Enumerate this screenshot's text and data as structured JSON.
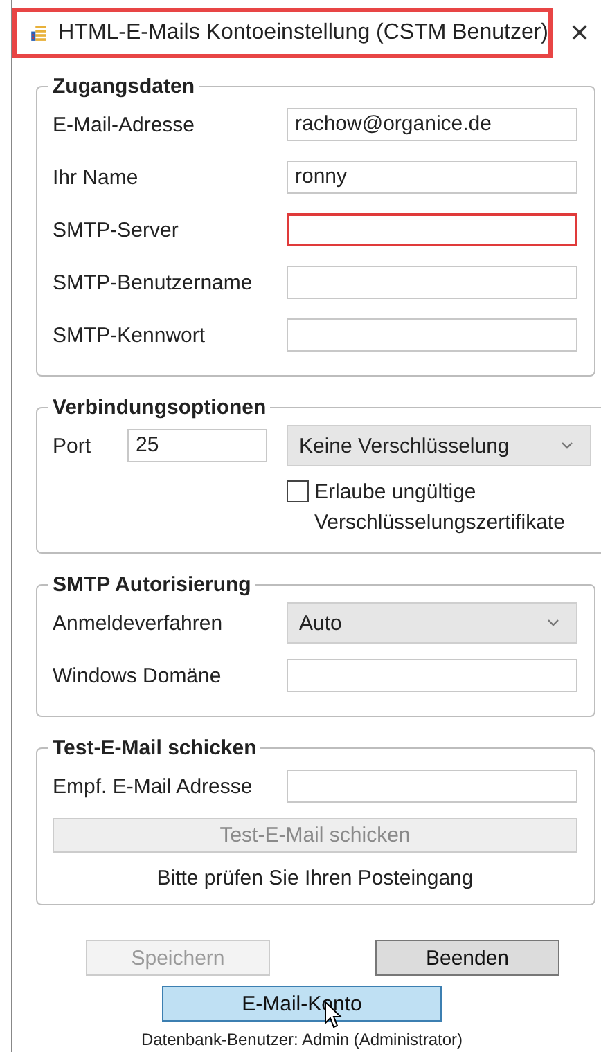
{
  "window": {
    "title": "HTML-E-Mails Kontoeinstellung (CSTM Benutzer)",
    "highlighted": true,
    "close": "✕"
  },
  "sections": [
    {
      "title": "Zugangsdaten",
      "rows": [
        {
          "kind": "field",
          "label": "E-Mail-Adresse",
          "value": "rachow@organice.de",
          "error": false
        },
        {
          "kind": "field",
          "label": "Ihr Name",
          "value": "ronny",
          "error": false
        },
        {
          "kind": "field",
          "label": "SMTP-Server",
          "value": "",
          "error": true
        },
        {
          "kind": "field",
          "label": "SMTP-Benutzername",
          "value": "",
          "error": false
        },
        {
          "kind": "field",
          "label": "SMTP-Kennwort",
          "value": "",
          "error": false
        }
      ]
    },
    {
      "title": "Verbindungsoptionen",
      "rows": [
        {
          "kind": "port",
          "label": "Port",
          "value": "25",
          "select": "Keine Verschlüsselung"
        },
        {
          "kind": "checkbox",
          "label": "Erlaube ungültige Verschlüsselungszertifikate",
          "checked": false
        }
      ]
    },
    {
      "title": "SMTP Autorisierung",
      "rows": [
        {
          "kind": "select",
          "label": "Anmeldeverfahren",
          "value": "Auto"
        },
        {
          "kind": "field",
          "label": "Windows Domäne",
          "value": "",
          "error": false
        }
      ]
    },
    {
      "title": "Test-E-Mail schicken",
      "rows": [
        {
          "kind": "field",
          "label": "Empf. E-Mail Adresse",
          "value": "",
          "error": false
        },
        {
          "kind": "button",
          "label": "Test-E-Mail schicken",
          "disabled": true
        },
        {
          "kind": "note",
          "label": "Bitte prüfen Sie Ihren Posteingang"
        }
      ]
    }
  ],
  "buttons": [
    {
      "label": "Speichern",
      "disabled": true
    },
    {
      "label": "Beenden",
      "disabled": false
    }
  ],
  "account_button": {
    "label": "E-Mail-Konto",
    "hovered": true
  },
  "footer": "Datenbank-Benutzer: Admin (Administrator)"
}
